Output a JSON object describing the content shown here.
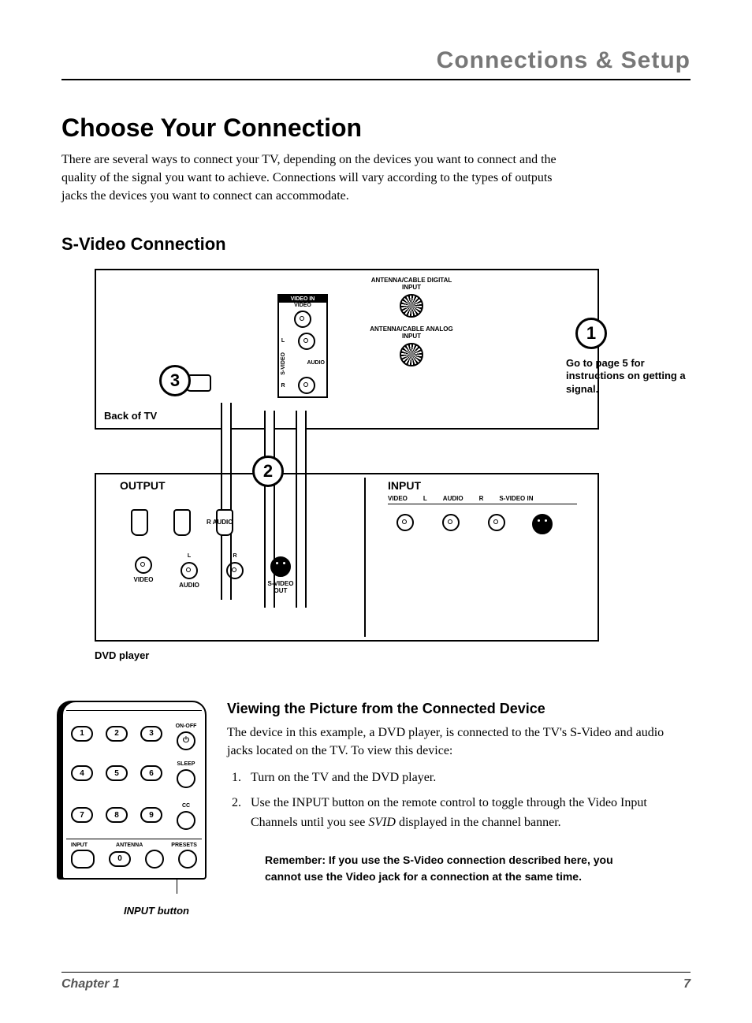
{
  "running_head": "Connections & Setup",
  "title": "Choose Your Connection",
  "intro": "There are several ways to connect your TV, depending on the devices you want to connect and the quality of the signal you want to achieve. Connections will vary according to the types of outputs jacks the devices you want to connect can accommodate.",
  "subsection": "S-Video Connection",
  "diagram": {
    "steps": {
      "one": "1",
      "two": "2",
      "three": "3"
    },
    "step1_caption": "Go to page 5 for instructions on getting a signal.",
    "back_tv": "Back of TV",
    "tv_panel": {
      "video_in": "VIDEO IN",
      "video": "VIDEO",
      "l": "L",
      "r": "R",
      "audio": "AUDIO",
      "svideo": "S-VIDEO"
    },
    "antenna": {
      "digital": "ANTENNA/CABLE DIGITAL INPUT",
      "analog": "ANTENNA/CABLE ANALOG INPUT"
    },
    "device": {
      "output": "OUTPUT",
      "input": "INPUT",
      "out_jacks": {
        "video": "VIDEO",
        "l": "L",
        "r": "R",
        "audio": "AUDIO",
        "svideo_out": "S-VIDEO OUT",
        "r_audio": "R AUDIO"
      },
      "in_jacks": {
        "video": "VIDEO",
        "l": "L",
        "audio": "AUDIO",
        "r": "R",
        "svideo_in": "S-VIDEO IN"
      }
    },
    "dvd_caption": "DVD player"
  },
  "remote": {
    "on_off": "ON-OFF",
    "sleep": "SLEEP",
    "cc": "CC",
    "input": "INPUT",
    "antenna": "ANTENNA",
    "presets": "PRESETS",
    "nums": [
      "1",
      "2",
      "3",
      "4",
      "5",
      "6",
      "7",
      "8",
      "9",
      "0"
    ],
    "caption": "INPUT button"
  },
  "viewing": {
    "heading": "Viewing the Picture from the Connected Device",
    "para": "The device in this example, a DVD player, is connected to the TV's S-Video and audio jacks located on the TV. To view this device:",
    "step1": "Turn on the TV and the DVD player.",
    "step2_a": "Use the INPUT button on the remote control to toggle through the Video Input Channels until you see ",
    "step2_svid": "SVID",
    "step2_b": " displayed in the channel banner.",
    "note": "Remember: If you use the S-Video connection described here, you cannot use the Video jack for a connection at the same time."
  },
  "footer": {
    "chapter": "Chapter 1",
    "page": "7"
  }
}
